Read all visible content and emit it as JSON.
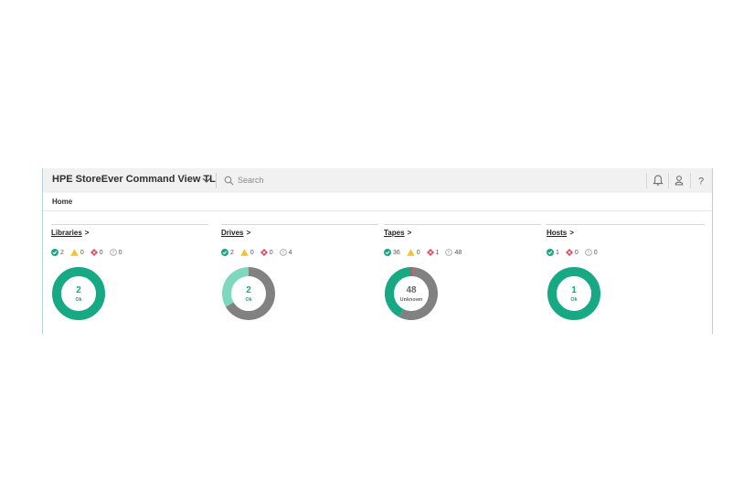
{
  "app": {
    "title": "HPE StoreEver Command View TL"
  },
  "search": {
    "placeholder": "Search"
  },
  "toolbar": {
    "notifications_icon": "bell-icon",
    "user_icon": "user-icon",
    "help_label": "?"
  },
  "breadcrumb": "Home",
  "colors": {
    "ok": "#17a884",
    "ok_light": "#7dd8bd",
    "unknown": "#818181",
    "warning": "#f2c234",
    "critical": "#e2455a",
    "accent_border": "#b8cfe0"
  },
  "cards": [
    {
      "title": "Libraries",
      "arrow": ">",
      "status": {
        "ok": "2",
        "warning": "0",
        "critical": "0",
        "unknown": "0"
      },
      "donut": {
        "value": "2",
        "label": "Ok",
        "segments": [
          {
            "name": "ok",
            "value": 2
          }
        ]
      }
    },
    {
      "title": "Drives",
      "arrow": ">",
      "status": {
        "ok": "2",
        "warning": "0",
        "critical": "0",
        "unknown": "4"
      },
      "donut": {
        "value": "2",
        "label": "Ok",
        "segments": [
          {
            "name": "ok",
            "value": 2
          },
          {
            "name": "unknown",
            "value": 4
          }
        ]
      }
    },
    {
      "title": "Tapes",
      "arrow": ">",
      "status": {
        "ok": "36",
        "warning": "0",
        "critical": "1",
        "unknown": "48"
      },
      "donut": {
        "value": "48",
        "label": "Unknown",
        "segments": [
          {
            "name": "ok",
            "value": 36
          },
          {
            "name": "critical",
            "value": 1
          },
          {
            "name": "unknown",
            "value": 48
          }
        ]
      }
    },
    {
      "title": "Hosts",
      "arrow": ">",
      "status": {
        "ok": "1",
        "critical": "0",
        "unknown": "0"
      },
      "donut": {
        "value": "1",
        "label": "Ok",
        "segments": [
          {
            "name": "ok",
            "value": 1
          }
        ]
      }
    }
  ]
}
